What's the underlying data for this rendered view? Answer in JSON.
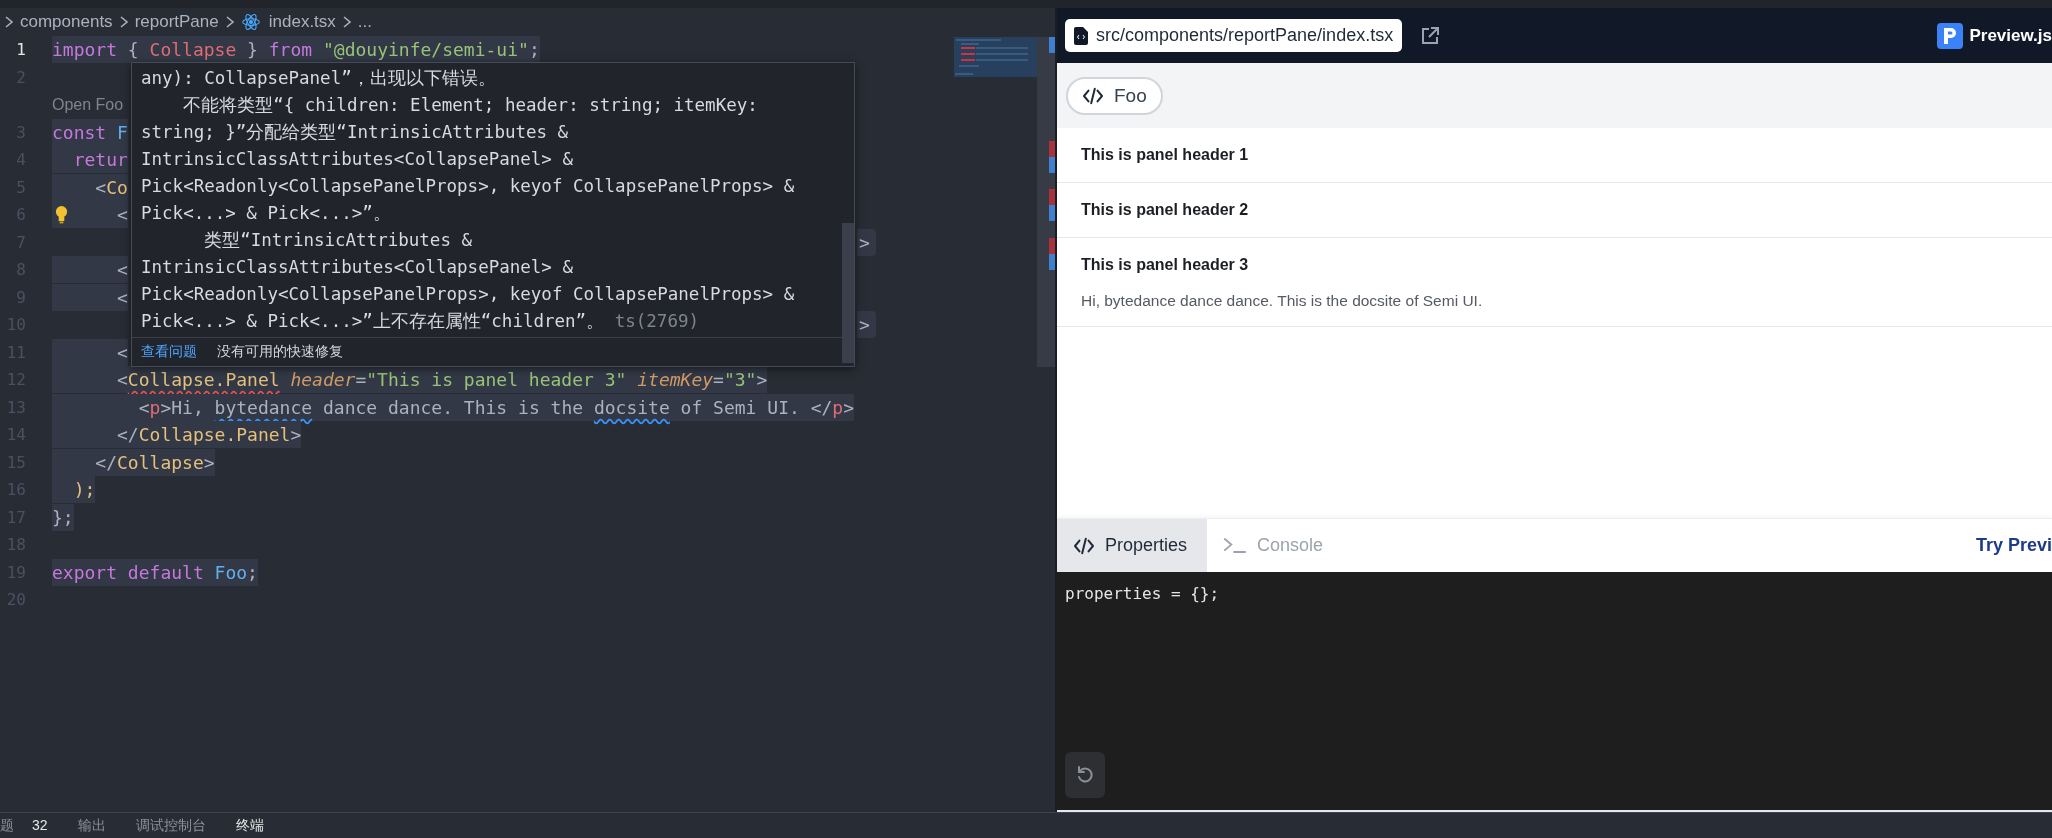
{
  "editor": {
    "breadcrumb": [
      {
        "label": "components",
        "kind": "folder"
      },
      {
        "label": "reportPane",
        "kind": "folder"
      },
      {
        "label": "index.tsx",
        "kind": "react"
      },
      {
        "label": "...",
        "kind": "more"
      }
    ],
    "lines": [
      {
        "kind": "code",
        "number": "1",
        "active": true,
        "tokens": [
          {
            "text": "import",
            "kind": "kw"
          },
          {
            "text": " { ",
            "kind": "punct"
          },
          {
            "text": "Collapse",
            "kind": "var"
          },
          {
            "text": " } ",
            "kind": "punct"
          },
          {
            "text": "from",
            "kind": "kw"
          },
          {
            "text": " \"@douyinfe/semi-ui\"",
            "kind": "str"
          },
          {
            "text": ";",
            "kind": "punct"
          }
        ]
      },
      {
        "kind": "code",
        "number": "2",
        "active": false
      },
      {
        "kind": "codelens",
        "text": "Open Foo"
      },
      {
        "kind": "code",
        "number": "3",
        "active": false,
        "tokens": [
          {
            "text": "const",
            "kind": "kw"
          },
          {
            "text": " F",
            "kind": "fn"
          }
        ]
      },
      {
        "kind": "code",
        "number": "4",
        "active": false,
        "tokens": [
          {
            "text": "  retur",
            "kind": "kw"
          }
        ]
      },
      {
        "kind": "code",
        "number": "5",
        "active": false,
        "tokens": [
          {
            "text": "    <",
            "kind": "punct"
          },
          {
            "text": "Co",
            "kind": "tag"
          }
        ]
      },
      {
        "kind": "code",
        "number": "6",
        "active": false,
        "lightbulb": true,
        "tokens": [
          {
            "text": "      <",
            "kind": "punct"
          }
        ]
      },
      {
        "kind": "code",
        "number": "7",
        "active": false,
        "tail": ">"
      },
      {
        "kind": "code",
        "number": "8",
        "active": false,
        "tokens": [
          {
            "text": "      <",
            "kind": "punct"
          }
        ]
      },
      {
        "kind": "code",
        "number": "9",
        "active": false,
        "tokens": [
          {
            "text": "      <",
            "kind": "punct"
          }
        ]
      },
      {
        "kind": "code",
        "number": "10",
        "active": false,
        "tail": ">"
      },
      {
        "kind": "code",
        "number": "11",
        "active": false,
        "tokens": [
          {
            "text": "      <",
            "kind": "punct"
          }
        ]
      },
      {
        "kind": "code",
        "number": "12",
        "active": false,
        "tokens": [
          {
            "text": "      <",
            "kind": "punct"
          },
          {
            "text": "Collapse.Panel",
            "kind": "tag",
            "error": true
          },
          {
            "text": " header",
            "kind": "attr"
          },
          {
            "text": "=",
            "kind": "punct"
          },
          {
            "text": "\"This is panel header 3\"",
            "kind": "str"
          },
          {
            "text": " itemKey",
            "kind": "attr"
          },
          {
            "text": "=",
            "kind": "punct"
          },
          {
            "text": "\"3\"",
            "kind": "str"
          },
          {
            "text": ">",
            "kind": "punct"
          }
        ]
      },
      {
        "kind": "code",
        "number": "13",
        "active": false,
        "tokens": [
          {
            "text": "        <",
            "kind": "punct"
          },
          {
            "text": "p",
            "kind": "ptag"
          },
          {
            "text": ">",
            "kind": "punct"
          },
          {
            "text": "Hi, ",
            "kind": "plain"
          },
          {
            "text": "bytedance",
            "kind": "plain",
            "spelling": true
          },
          {
            "text": " dance dance. This is the ",
            "kind": "plain"
          },
          {
            "text": "docsite",
            "kind": "plain",
            "spelling": true
          },
          {
            "text": " of Semi UI. ",
            "kind": "plain"
          },
          {
            "text": "</",
            "kind": "punct"
          },
          {
            "text": "p",
            "kind": "ptag"
          },
          {
            "text": ">",
            "kind": "punct"
          }
        ]
      },
      {
        "kind": "code",
        "number": "14",
        "active": false,
        "tokens": [
          {
            "text": "      </",
            "kind": "punct"
          },
          {
            "text": "Collapse.Panel",
            "kind": "tag"
          },
          {
            "text": ">",
            "kind": "punct"
          }
        ]
      },
      {
        "kind": "code",
        "number": "15",
        "active": false,
        "tokens": [
          {
            "text": "    </",
            "kind": "punct"
          },
          {
            "text": "Collapse",
            "kind": "tag"
          },
          {
            "text": ">",
            "kind": "punct"
          }
        ]
      },
      {
        "kind": "code",
        "number": "16",
        "active": false,
        "tokens": [
          {
            "text": "  );",
            "kind": "paren"
          }
        ]
      },
      {
        "kind": "code",
        "number": "17",
        "active": false,
        "tokens": [
          {
            "text": "};",
            "kind": "punct"
          }
        ]
      },
      {
        "kind": "code",
        "number": "18",
        "active": false
      },
      {
        "kind": "code",
        "number": "19",
        "active": false,
        "tokens": [
          {
            "text": "export",
            "kind": "kw"
          },
          {
            "text": " default",
            "kind": "kw"
          },
          {
            "text": " Foo",
            "kind": "fn"
          },
          {
            "text": ";",
            "kind": "punct"
          }
        ]
      },
      {
        "kind": "code",
        "number": "20",
        "active": false
      }
    ],
    "hover": {
      "lines": [
        {
          "text": "any): CollapsePanel”，出现以下错误。"
        },
        {
          "text": "    不能将类型“{ children: Element; header: string; itemKey:"
        },
        {
          "text": "string; }”分配给类型“IntrinsicAttributes &"
        },
        {
          "text": "IntrinsicClassAttributes<CollapsePanel> &"
        },
        {
          "text": "Pick<Readonly<CollapsePanelProps>, keyof CollapsePanelProps> &"
        },
        {
          "text": "Pick<...> & Pick<...>”。"
        },
        {
          "text": "      类型“IntrinsicAttributes &"
        },
        {
          "text": "IntrinsicClassAttributes<CollapsePanel> &"
        },
        {
          "text": "Pick<Readonly<CollapsePanelProps>, keyof CollapsePanelProps> &"
        },
        {
          "text": "Pick<...> & Pick<...>”上不存在属性“children”。",
          "suffix": "ts(2769)"
        }
      ],
      "actions": [
        {
          "label": "查看问题",
          "kind": "link"
        },
        {
          "label": "没有可用的快速修复",
          "kind": "text"
        }
      ]
    }
  },
  "preview": {
    "file_path": "src/components/reportPane/index.tsx",
    "brand": "Preview.js",
    "components": [
      {
        "label": "Foo",
        "selected": true
      }
    ],
    "panels": [
      {
        "header": "This is panel header 1"
      },
      {
        "header": "This is panel header 2"
      },
      {
        "header": "This is panel header 3",
        "content": "Hi, bytedance dance dance. This is the docsite of Semi UI."
      }
    ],
    "tabs": [
      {
        "label": "Properties",
        "kind": "code",
        "selected": true
      },
      {
        "label": "Console",
        "kind": "terminal",
        "selected": false
      }
    ],
    "try_link": "Try Previ",
    "console_text": "properties = {};"
  },
  "bottom_panel": {
    "tabs": [
      {
        "label": "题",
        "count": "32",
        "selected": false
      },
      {
        "label": "输出",
        "selected": false
      },
      {
        "label": "调试控制台",
        "selected": false
      },
      {
        "label": "终端",
        "selected": true
      }
    ]
  }
}
